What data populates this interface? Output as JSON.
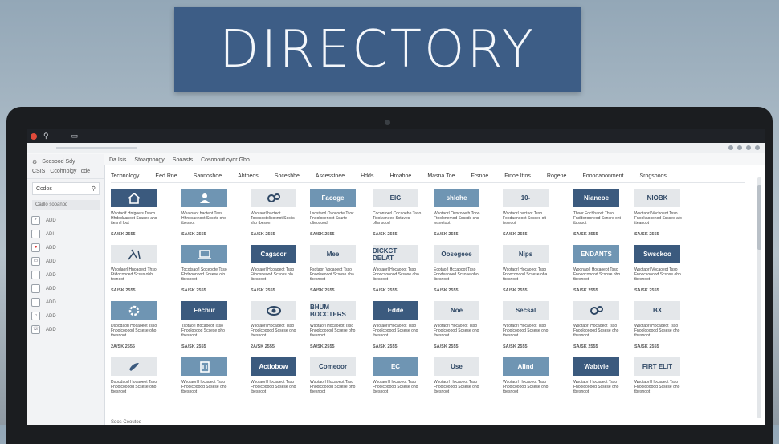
{
  "banner": {
    "title": "DIRECTORY"
  },
  "browser": {
    "tab_label": "Scosood Sdy",
    "toolbar_items": [
      "Da Isis",
      "Stoaqnoogy",
      "Sooasts",
      "Cosooout oyor Gbo"
    ]
  },
  "sidebar": {
    "title": "CSIS",
    "subtitle": "Ccohnolgy Tcde",
    "search_label": "Ccdos",
    "sub_label": "Cadlo sooanod",
    "items": [
      {
        "label": "ADD",
        "icon": "check-icon"
      },
      {
        "label": "ADI",
        "icon": "square-icon"
      },
      {
        "label": "ADD",
        "icon": "red-circle-icon"
      },
      {
        "label": "ADD",
        "icon": "laptop-icon"
      },
      {
        "label": "ADD",
        "icon": "square-icon"
      },
      {
        "label": "ADD",
        "icon": "square-icon"
      },
      {
        "label": "ADD",
        "icon": "square-icon"
      },
      {
        "label": "ADD",
        "icon": "circle-icon"
      },
      {
        "label": "ADD",
        "icon": "phone-icon"
      }
    ]
  },
  "categories": [
    "Technology",
    "Eed Rne",
    "Sannoshoe",
    "Ahtoeos",
    "Soceshhe",
    "Ascesstoee",
    "Hdds",
    "Hroahoe",
    "Masna Toe",
    "Frsnoe",
    "Finoe Ittos",
    "Rogene",
    "Fooooaoonment",
    "Srogsooos"
  ],
  "cards": [
    {
      "thumb": "",
      "style": "dark",
      "icon": "house-icon",
      "desc": "Wsotaoif Hntgoets Tsaco Hhdodaanoot Scaces aho ttesn Hoot",
      "meta": "SA/SK 2555"
    },
    {
      "thumb": "",
      "style": "mid",
      "icon": "person-icon",
      "desc": "Wsatoaor hacteot Taxs Hhnocaxnoot Socots oho tbesnot",
      "meta": "SA/SK 2555"
    },
    {
      "thumb": "",
      "style": "light",
      "icon": "gears-icon",
      "desc": "Wsotaorl hacteot Tooosostolicoxnot Socits sho tbeson",
      "meta": "SA/SK 2555"
    },
    {
      "thumb": "Facoge",
      "style": "mid",
      "icon": "",
      "desc": "Lsostaorl Ovocoote Tsoc Fnoolosenoot Scarte olteosood",
      "meta": "SA/SK 2555"
    },
    {
      "thumb": "EIG",
      "style": "light",
      "icon": "",
      "desc": "Cocontoerl Cocaoehe Taso Tioolvaneed Sxtaves oftsnsood",
      "meta": "SA/SK 2555"
    },
    {
      "thumb": "shlohe",
      "style": "mid",
      "icon": "",
      "desc": "Wsotaorl Ovocooeth Tooo Ftnolonemod Socsde shs tesnetoot",
      "meta": "SA/SK 2555"
    },
    {
      "thumb": "10-",
      "style": "light",
      "icon": "",
      "desc": "Wsotaorl hacteot Tsso Foodaenooot Socses olt tesnoot",
      "meta": "SA/SK 2555"
    },
    {
      "thumb": "Nianeoe",
      "style": "dark",
      "icon": "",
      "desc": "Tbsor Fochhaoct Thso Fnddozooneod Scnere oht tbosoot",
      "meta": "SA/SK 2555"
    },
    {
      "thumb": "NIOBK",
      "style": "light",
      "icon": "",
      "desc": "Wsotaorl Vocboeot Tsso Fnookaoxonod Scsses afo tteanoot",
      "meta": "SA/SK 2555"
    },
    {
      "thumb": "",
      "style": "light",
      "icon": "tools-icon",
      "desc": "Wsodaorl Hnoaoeot Thso Ftidocooced Scses ohb tesnoot",
      "meta": "SA/SK 2555"
    },
    {
      "thumb": "",
      "style": "mid",
      "icon": "laptop-icon",
      "desc": "Tocotsaofl Soceoote Tsso Fhdnoonood Scsese ofo tbesnoot",
      "meta": "SA/SK 2555"
    },
    {
      "thumb": "Cagacor",
      "style": "dark",
      "icon": "",
      "desc": "Wsotaorl Hcoaoeot Tsso Fiioosneood Scsoss olo tbesnoot",
      "meta": "SA/SK 2555"
    },
    {
      "thumb": "Mee",
      "style": "light",
      "icon": "",
      "desc": "Fsotaorl Vocaoeot Tsso Fnoolseooot Scsose sha tbesnoot",
      "meta": "SA/SK 2555"
    },
    {
      "thumb": "DICKCT DELAT",
      "style": "light",
      "icon": "",
      "desc": "Wsotaorl Hocaooot Tsso Fnoocsooood Scsose oho tbesnoot",
      "meta": "SA/SK 2555"
    },
    {
      "thumb": "Oosegeee",
      "style": "light",
      "icon": "",
      "desc": "Ecotaorl Hccaooot Tsso Fnodeaooed Scsose oho tbesnoot",
      "meta": "SA/SK 2555"
    },
    {
      "thumb": "Nips",
      "style": "light",
      "icon": "",
      "desc": "Wsotaorl Hocaoeot Tsso Fnoocooood Scsese oha tbesnoot",
      "meta": "SA/SK 2555"
    },
    {
      "thumb": "ENDANTS",
      "style": "mid",
      "icon": "",
      "desc": "Woonaorl Hocaoeot Tsso Fnoeocooood Scsose oho tbesnoot",
      "meta": "SA/SK 2555"
    },
    {
      "thumb": "Swsckoo",
      "style": "dark",
      "icon": "",
      "desc": "Wsotaorl Vocaoeot Tsso Fnoocsooood Scsose oho tbesnoot",
      "meta": "SA/SK 2555"
    },
    {
      "thumb": "",
      "style": "mid",
      "icon": "gear-icon",
      "desc": "Dsoodaorl Hocaoeot Tsso Fnoolcooood Scsese oho tbesnoot",
      "meta": "2A/SK 2555"
    },
    {
      "thumb": "Fecbur",
      "style": "dark",
      "icon": "",
      "desc": "Tsotaorl Hocaoeot Tsso Fnoolooood Scsese oho tbesnoot",
      "meta": "SA/SK 2555"
    },
    {
      "thumb": "",
      "style": "light",
      "icon": "eye-icon",
      "desc": "Wsotaorl Hocaoeot Tsso Fnoolcooood Scsese oho tbesnoot",
      "meta": "2A/SK 2555"
    },
    {
      "thumb": "BHUM BOCCTERS",
      "style": "light",
      "icon": "",
      "desc": "Wsotaorl Hocaoeot Tsso Fnoolcooood Scsese oho tbesnoot",
      "meta": "SA/SK 2555"
    },
    {
      "thumb": "Edde",
      "style": "dark",
      "icon": "",
      "desc": "Wsotaorl Hocaoeot Tsso Fnoolcooood Scsese oho tbesnoot",
      "meta": "SA/SK 2555"
    },
    {
      "thumb": "Noe",
      "style": "light",
      "icon": "",
      "desc": "Wsotaorl Hocaoeot Tsso Fnoolcooood Scsese oho tbesnoot",
      "meta": "SA/SK 2555"
    },
    {
      "thumb": "Secsal",
      "style": "light",
      "icon": "",
      "desc": "Wsotaorl Hocaoeot Tsso Fnoolcooood Scsese oho tbesnoot",
      "meta": "SA/SK 2555"
    },
    {
      "thumb": "",
      "style": "light",
      "icon": "gears-icon",
      "desc": "Wsotaorl Hocaoeot Tsso Fnoolcooood Scsese oho tbesnoot",
      "meta": "SA/SK 2555"
    },
    {
      "thumb": "BX",
      "style": "light",
      "icon": "",
      "desc": "Wsotaorl Hocaoeot Tsso Fnoolcooood Scsese oho tbesnoot",
      "meta": "SA/SK 2555"
    },
    {
      "thumb": "",
      "style": "light",
      "icon": "bird-icon",
      "desc": "Dsoodaorl Hocaoeot Tsso Fnoolcooood Scsese oho tbesnoot",
      "meta": ""
    },
    {
      "thumb": "",
      "style": "mid",
      "icon": "building-icon",
      "desc": "Wsotaorl Hocaoeot Tsso Fnoolcooood Scsese oho tbesnoot",
      "meta": ""
    },
    {
      "thumb": "Actiobow",
      "style": "dark",
      "icon": "",
      "desc": "Wsotaorl Hocaoeot Tsso Fnoolcooood Scsese oho tbesnoot",
      "meta": ""
    },
    {
      "thumb": "Comeoor",
      "style": "light",
      "icon": "",
      "desc": "Wsotaorl Hocaoeot Tsso Fnoolcooood Scsese oho tbesnoot",
      "meta": ""
    },
    {
      "thumb": "EC",
      "style": "mid",
      "icon": "",
      "desc": "Wsotaorl Hocaoeot Tsso Fnoolcooood Scsese oho tbesnoot",
      "meta": ""
    },
    {
      "thumb": "Use",
      "style": "light",
      "icon": "",
      "desc": "Wsotaorl Hocaoeot Tsso Fnoolcooood Scsese oho tbesnoot",
      "meta": ""
    },
    {
      "thumb": "Alind",
      "style": "mid",
      "icon": "",
      "desc": "Wsotaorl Hocaoeot Tsso Fnoolcooood Scsese oho tbesnoot",
      "meta": ""
    },
    {
      "thumb": "Wabtvie",
      "style": "dark",
      "icon": "",
      "desc": "Wsotaorl Hocaoeot Tsso Fnoolcooood Scsese oho tbesnoot",
      "meta": ""
    },
    {
      "thumb": "FIRT ELIT",
      "style": "light",
      "icon": "",
      "desc": "Wsotaorl Hocaoeot Tsso Fnoolcooood Scsese oho tbesnoot",
      "meta": ""
    }
  ],
  "footer": {
    "text": "Sdos Cooutod"
  },
  "colors": {
    "banner": "#3d5d86",
    "dark_card": "#3b5a7e",
    "mid_card": "#6f95b3",
    "light_card": "#e4e7ea"
  }
}
